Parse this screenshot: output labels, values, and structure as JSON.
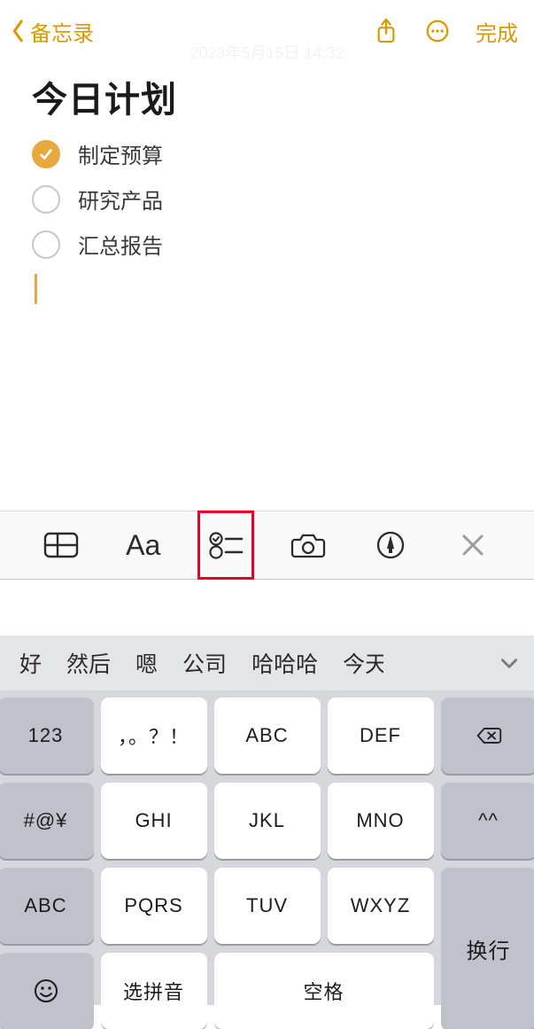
{
  "nav": {
    "back_label": "备忘录",
    "done_label": "完成"
  },
  "timestamp": "2023年5月15日 14:32",
  "note": {
    "title": "今日计划",
    "items": [
      {
        "text": "制定预算",
        "checked": true
      },
      {
        "text": "研究产品",
        "checked": false
      },
      {
        "text": "汇总报告",
        "checked": false
      }
    ]
  },
  "format_toolbar": {
    "aa_label": "Aa",
    "icons": [
      "table",
      "text-format",
      "checklist",
      "camera",
      "markup",
      "close"
    ]
  },
  "suggestions": {
    "items": [
      "好",
      "然后",
      "嗯",
      "公司",
      "哈哈哈",
      "今天"
    ]
  },
  "keyboard": {
    "rows": {
      "r1": {
        "fn": "123",
        "k1": "，。？！",
        "k2": "ABC",
        "k3": "DEF"
      },
      "r2": {
        "fn": "#@¥",
        "k1": "GHI",
        "k2": "JKL",
        "k3": "MNO",
        "face": "^^"
      },
      "r3": {
        "fn": "ABC",
        "k1": "PQRS",
        "k2": "TUV",
        "k3": "WXYZ"
      },
      "r4": {
        "pinyin": "选拼音",
        "space": "空格",
        "ret": "换行"
      }
    }
  }
}
